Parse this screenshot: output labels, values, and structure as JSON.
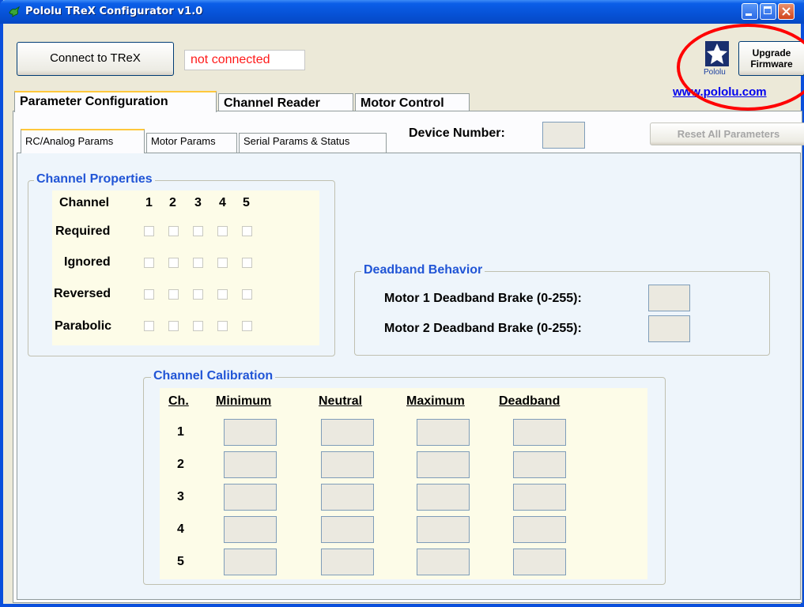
{
  "window": {
    "title": "Pololu TReX Configurator v1.0"
  },
  "toolbar": {
    "connect_label": "Connect to TReX",
    "status_text": "not connected",
    "upgrade_label_line1": "Upgrade",
    "upgrade_label_line2": "Firmware",
    "logo_text": "Pololu",
    "website_link": "www.pololu.com"
  },
  "main_tabs": [
    "Parameter Configuration",
    "Channel Reader",
    "Motor Control"
  ],
  "sub_tabs": [
    "RC/Analog Params",
    "Motor Params",
    "Serial Params & Status"
  ],
  "device": {
    "label": "Device Number:",
    "value": ""
  },
  "reset_label": "Reset All Parameters",
  "channel_properties": {
    "title": "Channel Properties",
    "header_label": "Channel",
    "channels": [
      "1",
      "2",
      "3",
      "4",
      "5"
    ],
    "rows": [
      "Required",
      "Ignored",
      "Reversed",
      "Parabolic"
    ]
  },
  "deadband_behavior": {
    "title": "Deadband Behavior",
    "motor1_label": "Motor 1 Deadband Brake (0-255):",
    "motor2_label": "Motor 2 Deadband Brake (0-255):",
    "motor1_value": "",
    "motor2_value": ""
  },
  "channel_calibration": {
    "title": "Channel Calibration",
    "headers": [
      "Ch.",
      "Minimum",
      "Neutral",
      "Maximum",
      "Deadband"
    ],
    "rows": [
      "1",
      "2",
      "3",
      "4",
      "5"
    ]
  },
  "colors": {
    "title_bar": "#0753d8",
    "group_title": "#2155d6",
    "status_text": "#ff1a1a",
    "annotation": "#ff0000"
  }
}
